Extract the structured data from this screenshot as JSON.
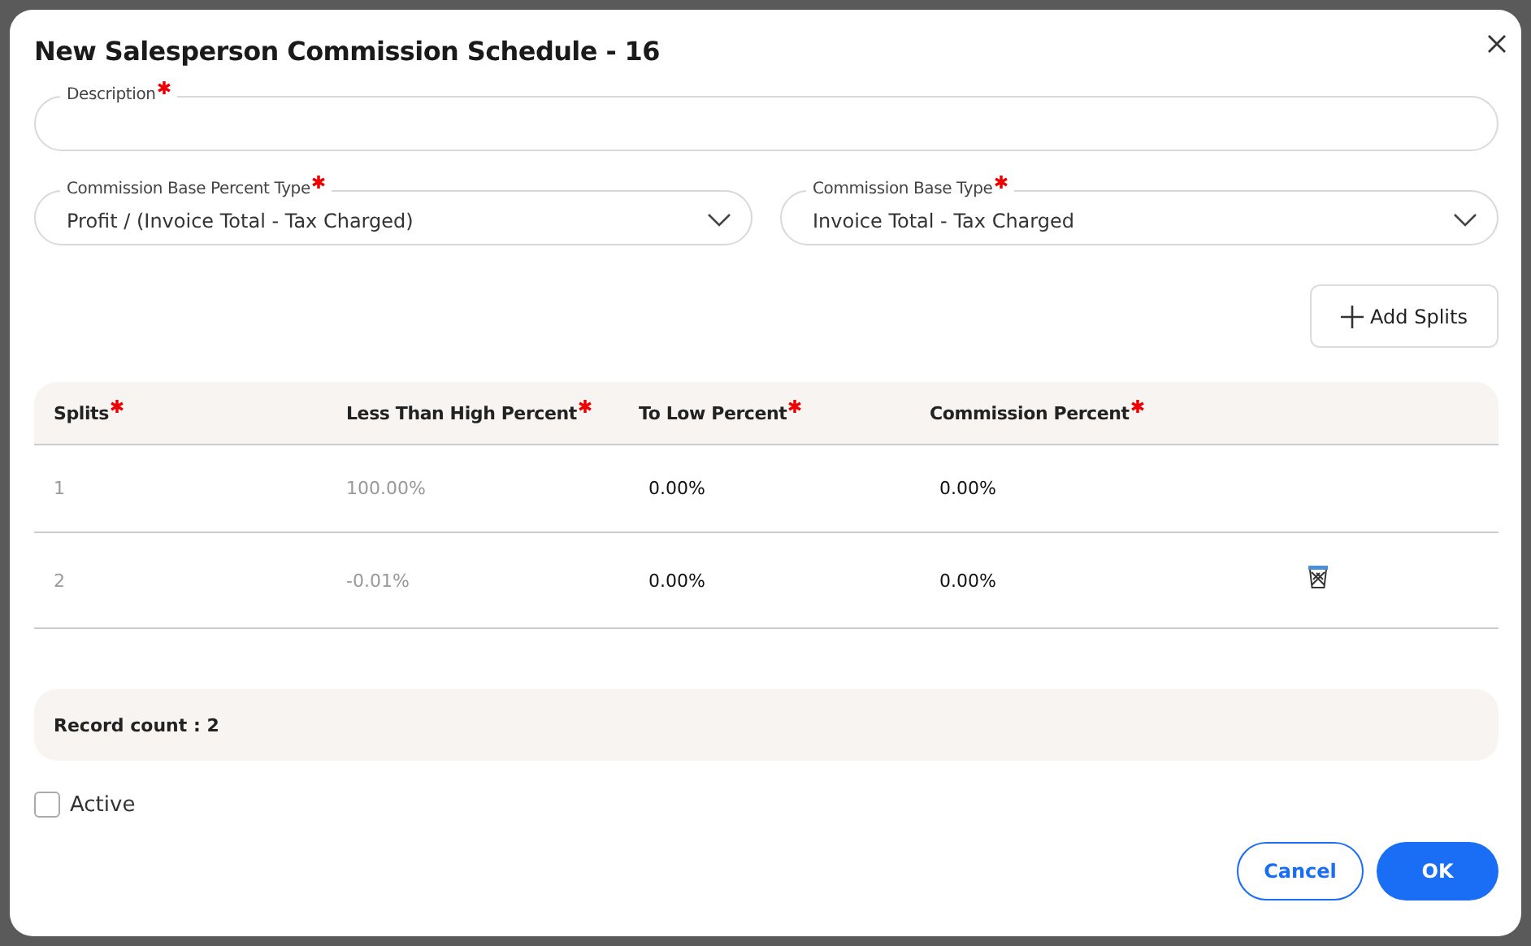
{
  "dialog": {
    "title": "New Salesperson Commission Schedule - 16"
  },
  "description": {
    "label": "Description",
    "required": true
  },
  "selects": [
    {
      "label": "Commission Base Percent Type",
      "required": true,
      "value": "Profit / (Invoice Total - Tax Charged)"
    },
    {
      "label": "Commission Base Type",
      "required": true,
      "value": "Invoice Total - Tax Charged"
    }
  ],
  "add_button": "Add Splits",
  "table": {
    "columns": [
      {
        "label": "Splits",
        "required": true
      },
      {
        "label": "Less Than High Percent",
        "required": true
      },
      {
        "label": "To Low Percent",
        "required": true
      },
      {
        "label": "Commission Percent",
        "required": true
      }
    ],
    "rows": [
      {
        "cells": [
          "1",
          "100.00%",
          "0.00%",
          "0.00%"
        ],
        "deletable": false
      },
      {
        "cells": [
          "2",
          "-0.01%",
          "0.00%",
          "0.00%"
        ],
        "deletable": true
      }
    ],
    "record_count": "Record count : 2"
  },
  "active": {
    "label": "Active",
    "checked": false
  },
  "buttons": {
    "cancel": "Cancel",
    "ok": "OK"
  }
}
